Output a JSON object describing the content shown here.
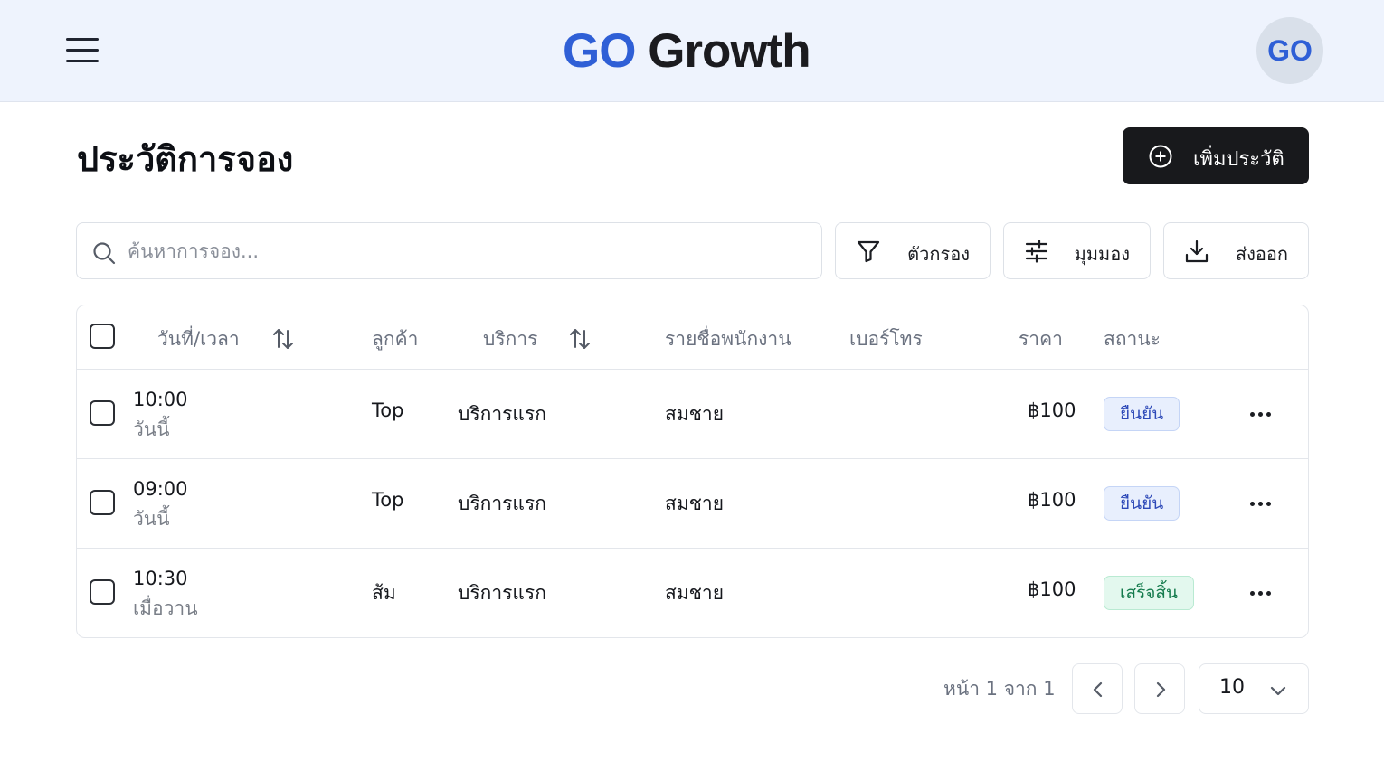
{
  "header": {
    "logo_go": "GO",
    "logo_growth": "Growth",
    "avatar_text": "GO",
    "brand_color": "#2f5fd6"
  },
  "page": {
    "title": "ประวัติการจอง",
    "add_button": "เพิ่มประวัติ"
  },
  "toolbar": {
    "search_placeholder": "ค้นหาการจอง...",
    "filter_label": "ตัวกรอง",
    "view_label": "มุมมอง",
    "export_label": "ส่งออก"
  },
  "table": {
    "columns": {
      "datetime": "วันที่/เวลา",
      "customer": "ลูกค้า",
      "service": "บริการ",
      "staff": "รายชื่อพนักงาน",
      "phone": "เบอร์โทร",
      "price": "ราคา",
      "status": "สถานะ"
    },
    "rows": [
      {
        "time": "10:00",
        "day": "วันนี้",
        "customer": "Top",
        "service": "บริการแรก",
        "staff": "สมชาย",
        "phone": "",
        "price": "฿100",
        "status": "ยืนยัน",
        "status_color": "blue"
      },
      {
        "time": "09:00",
        "day": "วันนี้",
        "customer": "Top",
        "service": "บริการแรก",
        "staff": "สมชาย",
        "phone": "",
        "price": "฿100",
        "status": "ยืนยัน",
        "status_color": "blue"
      },
      {
        "time": "10:30",
        "day": "เมื่อวาน",
        "customer": "ส้ม",
        "service": "บริการแรก",
        "staff": "สมชาย",
        "phone": "",
        "price": "฿100",
        "status": "เสร็จสิ้น",
        "status_color": "green"
      }
    ]
  },
  "pagination": {
    "info": "หน้า 1 จาก 1",
    "page_size": "10"
  }
}
